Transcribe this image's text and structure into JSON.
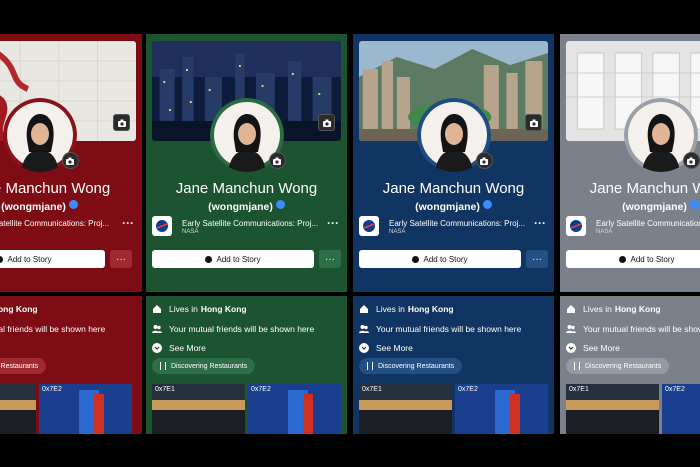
{
  "profile": {
    "name": "Jane Manchun Wong",
    "handle": "(wongmjane)",
    "work_title": "Early Satellite Communications: Proj...",
    "work_org": "NASA",
    "more": "···",
    "add_story": "Add to Story",
    "lives_prefix": "Lives in",
    "city": "Hong Kong",
    "mutual": "Your mutual friends will be shown here",
    "see_more": "See More",
    "activity": "Discovering Restaurants",
    "photo1": "0x7E1",
    "photo2": "0x7E2"
  },
  "themes": [
    {
      "name": "red",
      "bg": "#7e0c14"
    },
    {
      "name": "green",
      "bg": "#1c5431"
    },
    {
      "name": "blue",
      "bg": "#103563"
    },
    {
      "name": "gray",
      "bg": "#7b818b"
    }
  ],
  "icons": [
    "camera-icon",
    "verified-icon",
    "nasa-logo-icon",
    "home-icon",
    "friends-icon",
    "chevron-down-icon",
    "utensils-icon"
  ]
}
